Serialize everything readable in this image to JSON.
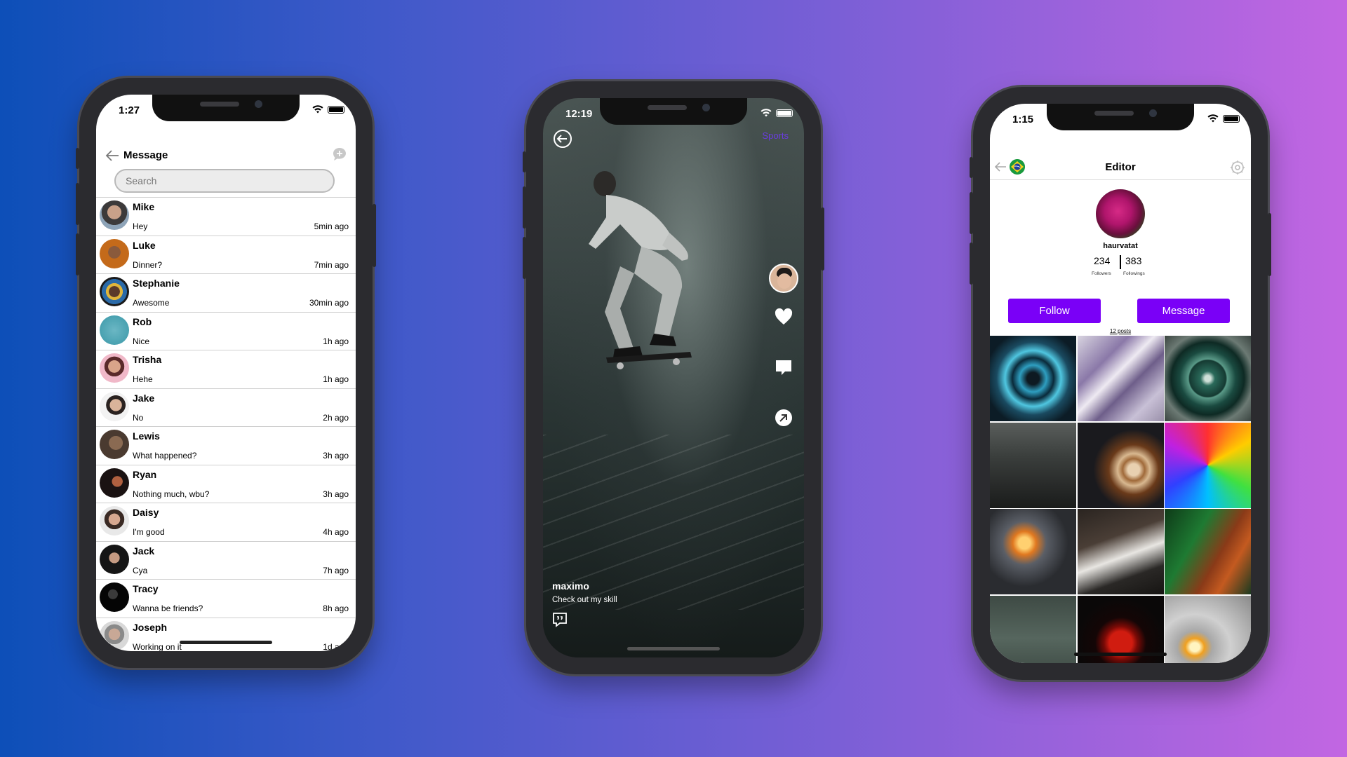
{
  "colors": {
    "accent": "#7a00f7",
    "sports_tag": "#6a3ce0",
    "bg_start": "#0d4fb8",
    "bg_end": "#c266e2"
  },
  "messages_screen": {
    "status_time": "1:27",
    "title": "Message",
    "search_placeholder": "Search",
    "icons": [
      "back-arrow-icon",
      "compose-bubble-icon",
      "wifi-icon",
      "battery-icon"
    ],
    "conversations": [
      {
        "name": "Mike",
        "last": "Hey",
        "time": "5min ago"
      },
      {
        "name": "Luke",
        "last": "Dinner?",
        "time": "7min ago"
      },
      {
        "name": "Stephanie",
        "last": "Awesome",
        "time": "30min ago"
      },
      {
        "name": "Rob",
        "last": "Nice",
        "time": "1h ago"
      },
      {
        "name": "Trisha",
        "last": "Hehe",
        "time": "1h ago"
      },
      {
        "name": "Jake",
        "last": "No",
        "time": "2h ago"
      },
      {
        "name": "Lewis",
        "last": "What happened?",
        "time": "3h ago"
      },
      {
        "name": "Ryan",
        "last": "Nothing much, wbu?",
        "time": "3h ago"
      },
      {
        "name": "Daisy",
        "last": "I'm good",
        "time": "4h ago"
      },
      {
        "name": "Jack",
        "last": "Cya",
        "time": "7h ago"
      },
      {
        "name": "Tracy",
        "last": "Wanna be friends?",
        "time": "8h ago"
      },
      {
        "name": "Joseph",
        "last": "Working on it",
        "time": "1d ago"
      }
    ]
  },
  "video_screen": {
    "status_time": "12:19",
    "category": "Sports",
    "username": "maximo",
    "caption": "Check out my skill",
    "icons": [
      "back-circle-icon",
      "creator-avatar",
      "heart-icon",
      "comment-icon",
      "share-icon",
      "quote-comment-icon"
    ]
  },
  "profile_screen": {
    "status_time": "1:15",
    "title": "Editor",
    "username": "haurvatat",
    "followers_count": "234",
    "followers_label": "Followers",
    "followings_count": "383",
    "followings_label": "Followings",
    "follow_button": "Follow",
    "message_button": "Message",
    "posts_label": "12 posts",
    "icons": [
      "back-arrow-icon",
      "brazil-flag-icon",
      "gear-icon"
    ]
  }
}
